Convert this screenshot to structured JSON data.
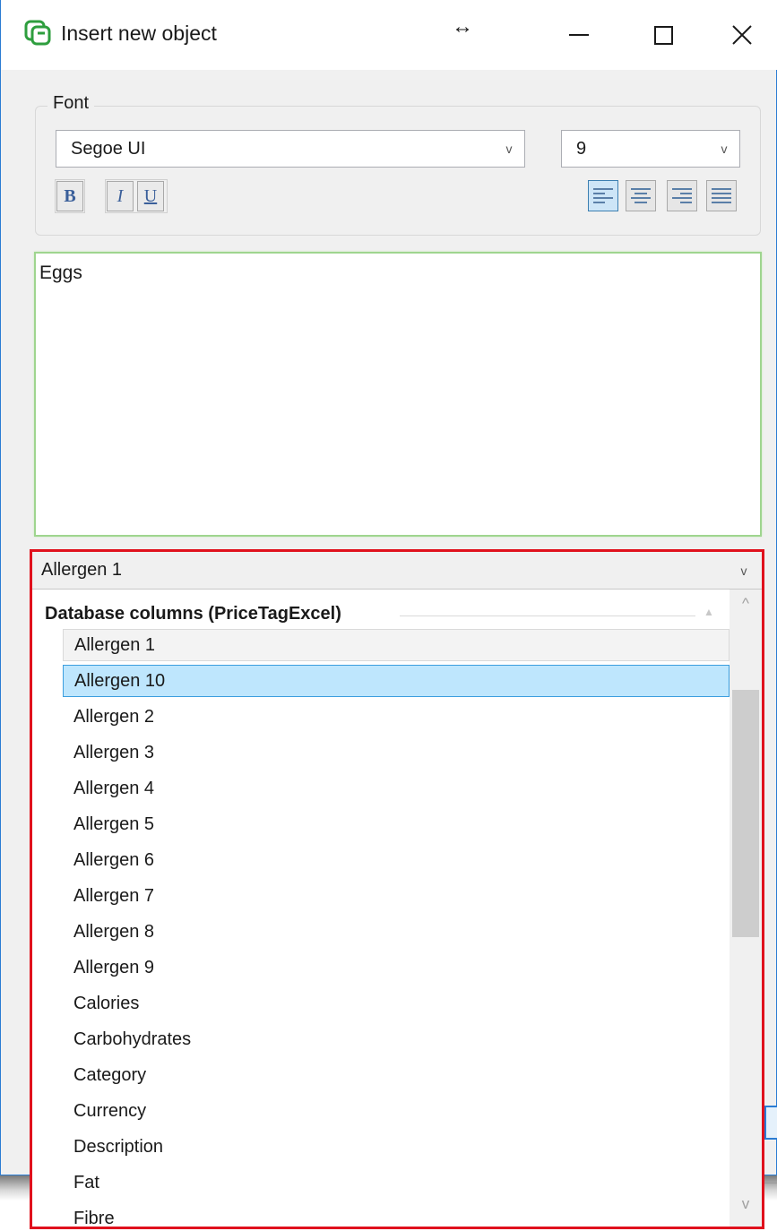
{
  "window": {
    "title": "Insert new object",
    "app_icon": "app-logo-icon",
    "controls": {
      "minimize": "minimize-icon",
      "maximize": "maximize-icon",
      "close": "close-icon"
    },
    "resize_cursor": "↔",
    "close_glyph": "✕"
  },
  "font": {
    "legend": "Font",
    "family": "Segoe UI",
    "size": "9",
    "format": {
      "bold": "B",
      "italic": "I",
      "underline": "U"
    },
    "alignment": "left"
  },
  "editor": {
    "text": "Eggs"
  },
  "dropdown": {
    "selected": "Allergen 1",
    "chevron": "v",
    "group_title": "Database columns (PriceTagExcel)",
    "items": [
      "Allergen 1",
      "Allergen 10",
      "Allergen 2",
      "Allergen 3",
      "Allergen 4",
      "Allergen 5",
      "Allergen 6",
      "Allergen 7",
      "Allergen 8",
      "Allergen 9",
      "Calories",
      "Carbohydrates",
      "Category",
      "Currency",
      "Description",
      "Fat",
      "Fibre"
    ],
    "current_item": "Allergen 1",
    "highlighted_item": "Allergen 10",
    "scroll": {
      "up_glyph": "^",
      "down_glyph": "v",
      "collapse_glyph": "▲"
    }
  },
  "colors": {
    "dropdown_highlight_border": "#e0111d",
    "selection_fill": "#bee6fd",
    "editor_focus_border": "#9fd58f",
    "window_border": "#2b7cd3"
  }
}
